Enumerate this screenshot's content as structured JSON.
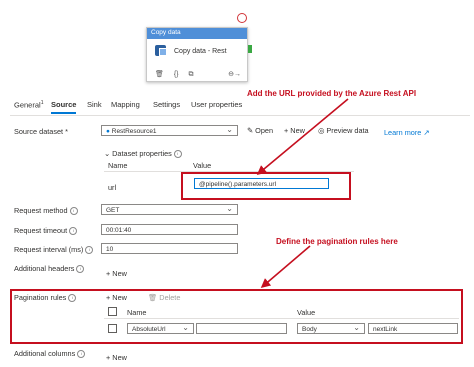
{
  "activity": {
    "header": "Copy data",
    "name": "Copy data - Rest",
    "tool_icons": [
      "delete-icon",
      "code-icon",
      "copy-icon"
    ],
    "run_icon": "output-arrow-icon"
  },
  "tabs": [
    {
      "label": "General",
      "badge": "1"
    },
    {
      "label": "Source",
      "active": true
    },
    {
      "label": "Sink"
    },
    {
      "label": "Mapping"
    },
    {
      "label": "Settings"
    },
    {
      "label": "User properties"
    }
  ],
  "source": {
    "dataset_label": "Source dataset",
    "required_mark": "*",
    "dataset_value": "RestResource1",
    "open_label": "Open",
    "new_label": "New",
    "preview_label": "Preview data",
    "learn_more": "Learn more",
    "dataset_properties": "Dataset properties",
    "name_col": "Name",
    "value_col": "Value",
    "url_name": "url",
    "url_value": "@pipeline().parameters.url",
    "request_method_label": "Request method",
    "request_method_value": "GET",
    "request_timeout_label": "Request timeout",
    "request_timeout_value": "00:01:40",
    "request_interval_label": "Request interval (ms)",
    "request_interval_value": "10",
    "additional_headers_label": "Additional headers",
    "add_new": "New",
    "pagination_label": "Pagination rules",
    "pagination_new": "New",
    "pagination_delete": "Delete",
    "pagination_name_col": "Name",
    "pagination_value_col": "Value",
    "pagination_name_value": "AbsoluteUrl",
    "pagination_type_value": "Body",
    "pagination_value_value": "nextLink",
    "additional_columns_label": "Additional columns",
    "additional_columns_new": "New"
  },
  "annotations": {
    "url_note": "Add the URL provided by the Azure Rest API",
    "pagination_note": "Define the pagination rules here",
    "color": "#c50f1f"
  },
  "colors": {
    "accent": "#0078d4",
    "activity_header": "#4f8fd8",
    "success": "#3aa843"
  }
}
